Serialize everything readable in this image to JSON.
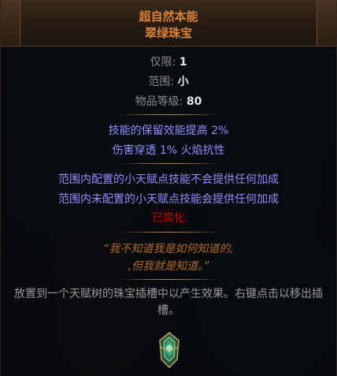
{
  "header": {
    "name": "超自然本能",
    "base_type": "翠绿珠宝"
  },
  "properties": {
    "limit_label": "仅限:",
    "limit_value": "1",
    "radius_label": "范围:",
    "radius_value": "小",
    "item_level_label": "物品等级:",
    "item_level_value": "80"
  },
  "mods": [
    "技能的保留效能提高 2%",
    "伤害穿透 1% 火焰抗性"
  ],
  "unique_mods": [
    "范围内配置的小天赋点技能不会提供任何加成",
    "范围内未配置的小天赋点技能会提供任何加成"
  ],
  "corrupted": "已腐化",
  "flavour": [
    "“我不知道我是如何知道的,",
    ",但我就是知道。”"
  ],
  "description": "放置到一个天赋树的珠宝插槽中以产生效果。右键点击以移出插槽。",
  "colors": {
    "unique_name": "#d9823b",
    "magic_mod": "#8f8fff",
    "corrupted": "#d20000",
    "flavour": "#b06a2a"
  },
  "icon": "jewel-icon"
}
